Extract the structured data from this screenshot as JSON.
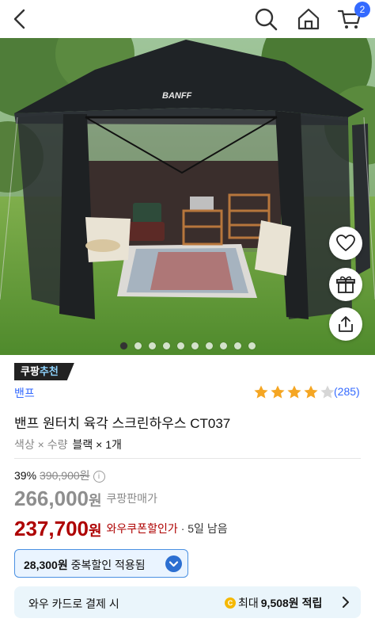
{
  "header": {
    "cart_count": "2",
    "icons": [
      "back-icon",
      "search-icon",
      "home-icon",
      "cart-icon"
    ]
  },
  "hero": {
    "image_description": "Black hexagonal screen house tent on grass with rug, folding chairs, coolers and wooden shelves",
    "tent_logo": "BANFF",
    "slide_count": 10,
    "active_slide": 1,
    "side_actions": [
      "heart-icon",
      "gift-icon",
      "share-icon"
    ]
  },
  "badge": {
    "label_part1": "쿠팡",
    "label_part2": "추천"
  },
  "product": {
    "brand": "밴프",
    "rating_stars": 4,
    "rating_count": "(285)",
    "title": "밴프 원터치 육각 스크린하우스 CT037",
    "option_label": "색상 × 수량",
    "option_value": "블랙 × 1개"
  },
  "pricing": {
    "discount_rate": "39%",
    "original_price": "390,900원",
    "info_icon": "ⓘ",
    "seller_price_num": "266,000",
    "seller_price_unit": "원",
    "seller_label": "쿠팡판매가",
    "coupon_price_num": "237,700",
    "coupon_price_unit": "원",
    "coupon_label": "와우쿠폰할인가",
    "days_left": "· 5일 남음",
    "extra_discount_amount": "28,300원",
    "extra_discount_text": "중복할인 적용됨"
  },
  "card_offer": {
    "left_text": "와우 카드로 결제 시",
    "coin_symbol": "C",
    "right_prefix": "최대",
    "right_amount": "9,508원 적립"
  },
  "colors": {
    "accent_blue": "#346aff",
    "price_red": "#ae0000",
    "price_gray": "#8e8e8e",
    "star_gold": "#f5a623"
  }
}
